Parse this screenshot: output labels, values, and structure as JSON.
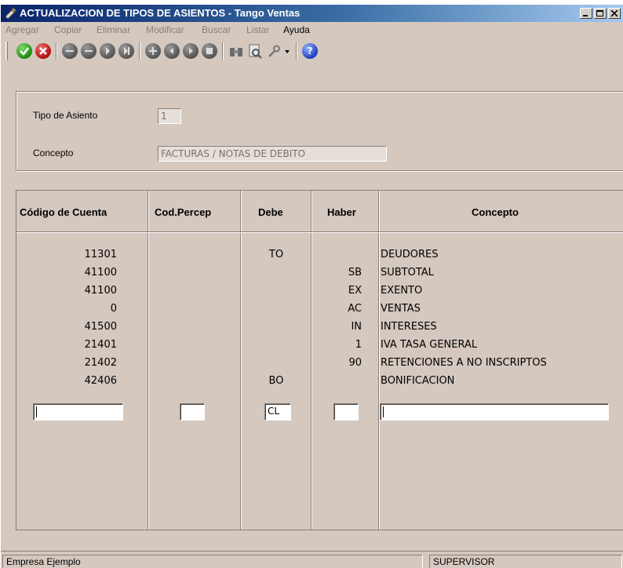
{
  "window": {
    "title": "ACTUALIZACION DE TIPOS DE ASIENTOS - Tango Ventas"
  },
  "menu": {
    "items": [
      {
        "label": "Agregar",
        "enabled": false
      },
      {
        "label": "Copiar",
        "enabled": false
      },
      {
        "label": "Eliminar",
        "enabled": false
      },
      {
        "label": "Modificar",
        "enabled": false
      },
      {
        "label": "Buscar",
        "enabled": false
      },
      {
        "label": "Listar",
        "enabled": false
      },
      {
        "label": "Ayuda",
        "enabled": true
      }
    ]
  },
  "toolbar": {
    "icons": [
      "accept-icon",
      "cancel-icon",
      "first-record-icon",
      "previous-record-icon",
      "next-record-icon",
      "last-record-icon",
      "add-icon",
      "copy-icon",
      "delete-icon",
      "modify-icon",
      "binoculars-icon",
      "print-preview-icon",
      "tools-icon",
      "dropdown-arrow-icon",
      "help-icon"
    ],
    "colors": {
      "accept": "#1e8a12",
      "cancel": "#b01010",
      "help": "#1f3fbf",
      "disabled": "#555555"
    }
  },
  "form": {
    "tipo_label": "Tipo de Asiento",
    "tipo_value": "1",
    "concepto_label": "Concepto",
    "concepto_value": "FACTURAS / NOTAS DE DEBITO"
  },
  "grid": {
    "headers": {
      "codigo": "Código de Cuenta",
      "percep": "Cod.Percep",
      "debe": "Debe",
      "haber": "Haber",
      "concepto": "Concepto"
    },
    "rows": [
      {
        "codigo": "11301",
        "percep": "",
        "debe": "TO",
        "haber": "",
        "concepto": "DEUDORES"
      },
      {
        "codigo": "41100",
        "percep": "",
        "debe": "",
        "haber": "SB",
        "concepto": "SUBTOTAL"
      },
      {
        "codigo": "41100",
        "percep": "",
        "debe": "",
        "haber": "EX",
        "concepto": "EXENTO"
      },
      {
        "codigo": "0",
        "percep": "",
        "debe": "",
        "haber": "AC",
        "concepto": "VENTAS"
      },
      {
        "codigo": "41500",
        "percep": "",
        "debe": "",
        "haber": "IN",
        "concepto": "INTERESES"
      },
      {
        "codigo": "21401",
        "percep": "",
        "debe": "",
        "haber": "1",
        "concepto": "IVA TASA GENERAL"
      },
      {
        "codigo": "21402",
        "percep": "",
        "debe": "",
        "haber": "90",
        "concepto": "RETENCIONES A NO INSCRIPTOS"
      },
      {
        "codigo": "42406",
        "percep": "",
        "debe": "BO",
        "haber": "",
        "concepto": "BONIFICACION"
      }
    ],
    "edit_row": {
      "codigo": "",
      "percep": "",
      "debe": "CL",
      "haber": "",
      "concepto": ""
    }
  },
  "status": {
    "empresa": "Empresa Ejemplo",
    "usuario": "SUPERVISOR"
  }
}
